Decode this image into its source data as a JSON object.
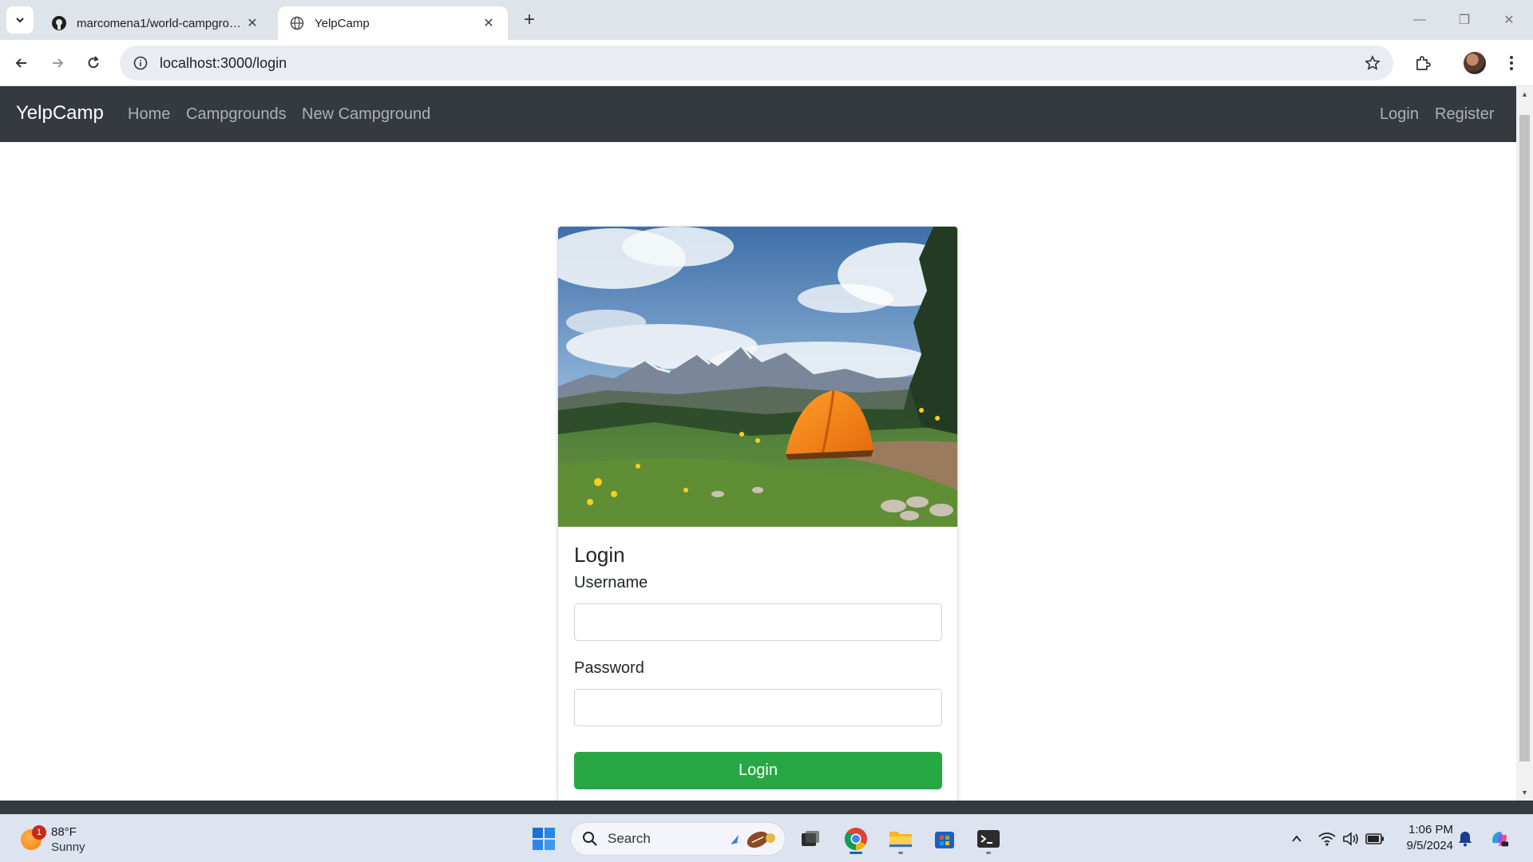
{
  "browser": {
    "tabs": [
      {
        "title": "marcomena1/world-campground",
        "active": false,
        "favicon": "github-icon"
      },
      {
        "title": "YelpCamp",
        "active": true,
        "favicon": "globe-icon"
      }
    ],
    "url": "localhost:3000/login"
  },
  "app": {
    "brand": "YelpCamp",
    "nav_left": [
      "Home",
      "Campgrounds",
      "New Campground"
    ],
    "nav_right": [
      "Login",
      "Register"
    ]
  },
  "login_card": {
    "title": "Login",
    "username_label": "Username",
    "password_label": "Password",
    "username_value": "",
    "password_value": "",
    "submit_label": "Login"
  },
  "taskbar": {
    "weather_temp": "88°F",
    "weather_condition": "Sunny",
    "weather_badge": "1",
    "search_placeholder": "Search",
    "time": "1:06 PM",
    "date": "9/5/2024"
  },
  "colors": {
    "navbar_bg": "#343a40",
    "login_button": "#28a745",
    "tabstrip": "#dfe3ea",
    "taskbar": "#dde3ef"
  }
}
